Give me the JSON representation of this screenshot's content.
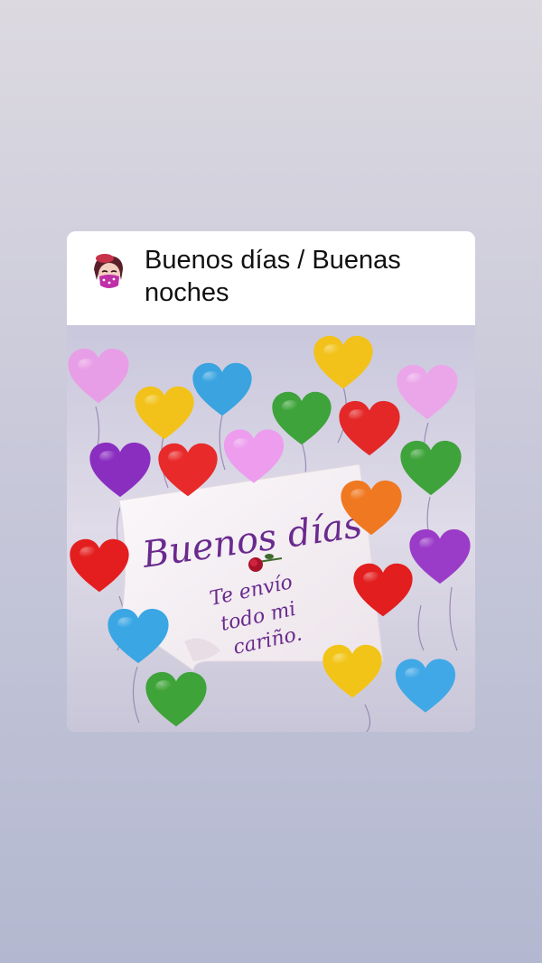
{
  "post": {
    "title": "Buenos días / Buenas noches"
  },
  "image": {
    "heading": "Buenos días",
    "line1": "Te envío",
    "line2": "todo mi",
    "line3": "cariño."
  },
  "colors": {
    "background_top": "#dcd9e0",
    "background_bottom": "#b3b8d0",
    "note": "#f7f3f6",
    "text_purple": "#6a2a8e"
  },
  "icons": [
    "avatar-sticker",
    "rose-icon",
    "heart-balloon"
  ]
}
